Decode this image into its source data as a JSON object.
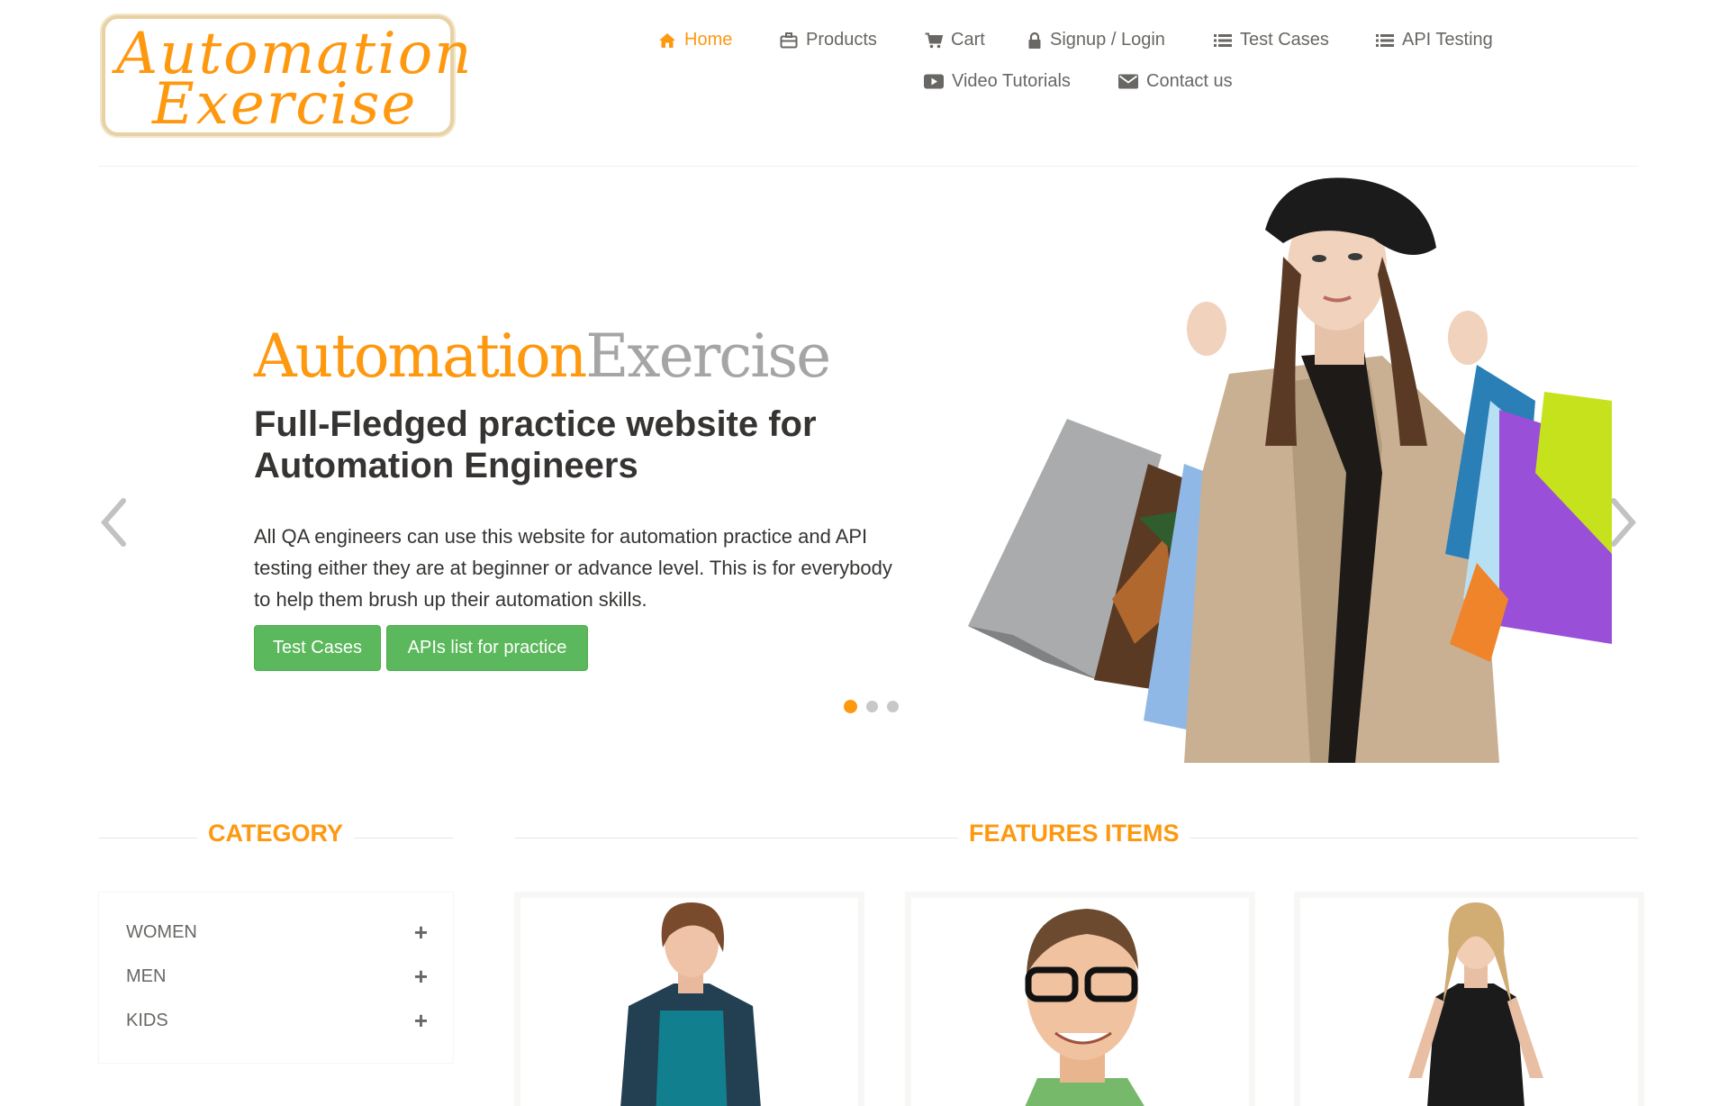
{
  "logo": {
    "line1": "Automation",
    "line2": "Exercise"
  },
  "nav": {
    "home": "Home",
    "products": "Products",
    "cart": "Cart",
    "signup_login": "Signup / Login",
    "test_cases": "Test Cases",
    "api_testing": "API Testing",
    "video_tutorials": "Video Tutorials",
    "contact_us": "Contact us"
  },
  "hero": {
    "title_part1": "Automation",
    "title_part2": "Exercise",
    "heading": "Full-Fledged practice website for Automation Engineers",
    "text": "All QA engineers can use this website for automation practice and API testing either they are at beginner or advance level. This is for everybody to help them brush up their automation skills.",
    "button_test_cases": "Test Cases",
    "button_apis": "APIs list for practice",
    "slide_count": 3,
    "active_slide": 1
  },
  "category": {
    "title": "CATEGORY",
    "items": [
      {
        "label": "WOMEN"
      },
      {
        "label": "MEN"
      },
      {
        "label": "KIDS"
      }
    ]
  },
  "features": {
    "title": "FEATURES ITEMS"
  },
  "colors": {
    "accent": "#FE980F",
    "button": "#5CB85C",
    "text": "#696763",
    "heading": "#363432"
  },
  "icons": [
    "home-icon",
    "briefcase-icon",
    "shopping-cart-icon",
    "lock-icon",
    "list-icon",
    "video-play-icon",
    "envelope-icon",
    "chevron-left-icon",
    "chevron-right-icon",
    "plus-icon"
  ]
}
